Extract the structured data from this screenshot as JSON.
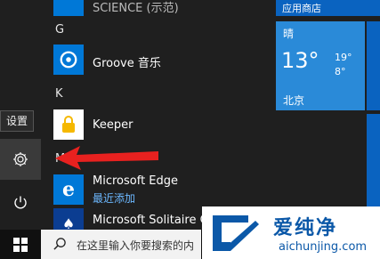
{
  "tooltip": {
    "settings": "设置"
  },
  "app_list": {
    "top_partial": "SCIENCE (示范)",
    "letters": {
      "g": "G",
      "k": "K",
      "m": "M"
    },
    "groove": {
      "name": "Groove 音乐"
    },
    "keeper": {
      "name": "Keeper"
    },
    "edge": {
      "name": "Microsoft Edge",
      "sub": "最近添加"
    },
    "solitaire": {
      "name": "Microsoft Solitaire Co"
    }
  },
  "tiles": {
    "store_label": "应用商店",
    "weather": {
      "condition": "晴",
      "temp": "13°",
      "high": "19°",
      "low": "8°",
      "city": "北京"
    }
  },
  "taskbar": {
    "search_placeholder": "在这里输入你要搜索的内"
  },
  "watermark": {
    "brand": "爱纯净",
    "url": "aichunjing.com"
  },
  "colors": {
    "accent": "#0078d7",
    "arrow": "#e8211f"
  }
}
